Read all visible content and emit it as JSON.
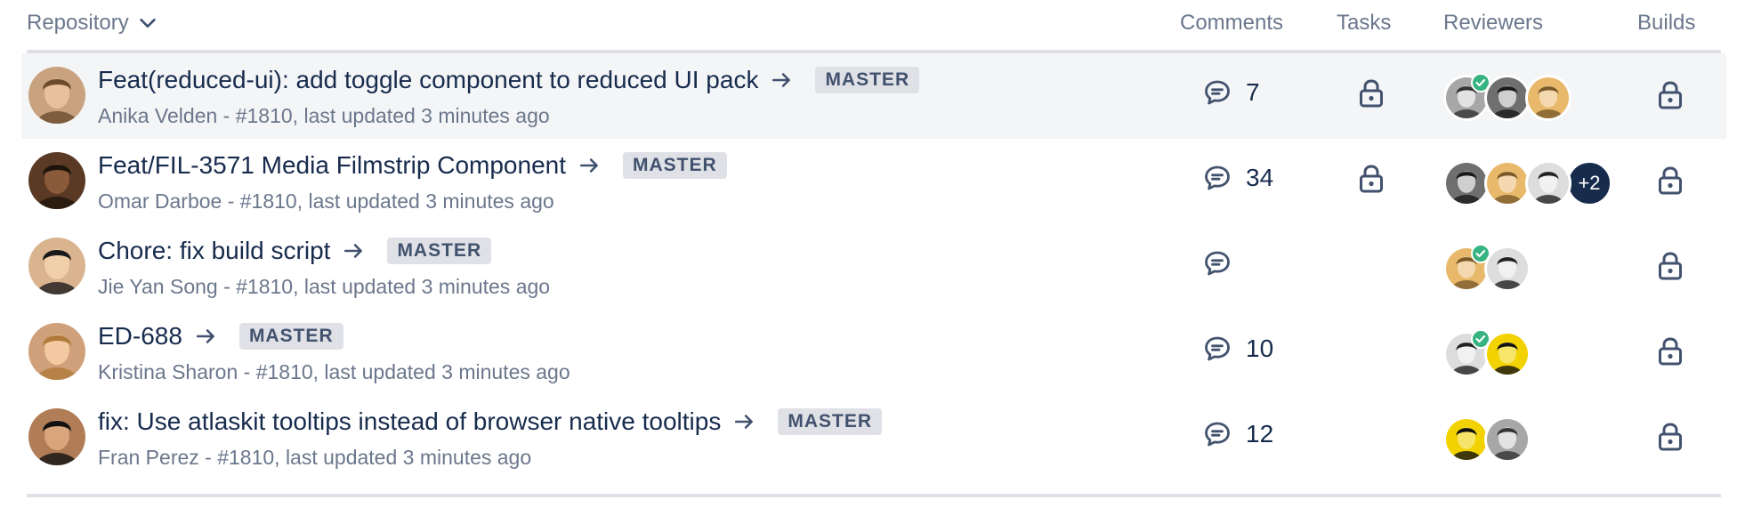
{
  "header": {
    "repository": "Repository",
    "comments": "Comments",
    "tasks": "Tasks",
    "reviewers": "Reviewers",
    "builds": "Builds"
  },
  "colors": {
    "text": "#172b4d",
    "subtle": "#6b778c",
    "lozenge_bg": "#dfe1e6",
    "approved": "#36b37e",
    "row_highlight": "#f4f5f7"
  },
  "rows": [
    {
      "title": "Feat(reduced-ui): add toggle component to reduced UI pack",
      "branch": "MASTER",
      "author": "Anika Velden",
      "details": "- #1810, last updated",
      "updated": "3 minutes ago",
      "comments": "7",
      "has_task_lock": true,
      "reviewers": [
        "reviewer-approved",
        "reviewer",
        "reviewer"
      ],
      "more_reviewers": ""
    },
    {
      "title": "Feat/FIL-3571 Media Filmstrip Component",
      "branch": "MASTER",
      "author": "Omar Darboe",
      "details": "- #1810, last updated",
      "updated": "3 minutes ago",
      "comments": "34",
      "has_task_lock": true,
      "reviewers": [
        "reviewer",
        "reviewer",
        "reviewer"
      ],
      "more_reviewers": "+2"
    },
    {
      "title": "Chore: fix build script",
      "branch": "MASTER",
      "author": "Jie Yan Song",
      "details": "- #1810, last updated",
      "updated": "3 minutes ago",
      "comments": "",
      "has_task_lock": false,
      "reviewers": [
        "reviewer-approved",
        "reviewer"
      ],
      "more_reviewers": ""
    },
    {
      "title": "ED-688",
      "branch": "MASTER",
      "author": "Kristina Sharon",
      "details": "- #1810, last updated",
      "updated": "3 minutes ago",
      "comments": "10",
      "has_task_lock": false,
      "reviewers": [
        "reviewer-approved",
        "reviewer"
      ],
      "more_reviewers": ""
    },
    {
      "title": "fix: Use atlaskit tooltips instead of browser native tooltips",
      "branch": "MASTER",
      "author": "Fran Perez",
      "details": "- #1810, last updated",
      "updated": "3 minutes ago",
      "comments": "12",
      "has_task_lock": false,
      "reviewers": [
        "reviewer",
        "reviewer"
      ],
      "more_reviewers": ""
    }
  ],
  "icons": {
    "sort": "chevron-down-icon",
    "arrow": "arrow-right-icon",
    "comment": "comment-icon",
    "lock": "lock-icon",
    "approved": "check-badge-icon"
  }
}
